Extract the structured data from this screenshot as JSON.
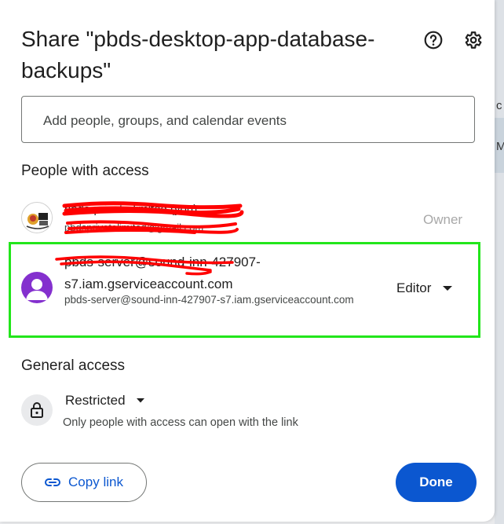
{
  "dialog": {
    "title": "Share \"pbds-desktop-app-database-backups\""
  },
  "add_people": {
    "placeholder": "Add people, groups, and calendar events"
  },
  "people_with_access": {
    "heading": "People with access",
    "owner": {
      "name": "pbds-private-limited (you)",
      "email": "pbdsprivatelimited@gmail.com",
      "role": "Owner"
    },
    "editor": {
      "name": "pbds-server@sound-inn-427907-s7.iam.gserviceaccount.com",
      "email": "pbds-server@sound-inn-427907-s7.iam.gserviceaccount.com",
      "role": "Editor"
    }
  },
  "general_access": {
    "heading": "General access",
    "mode": "Restricted",
    "description": "Only people with access can open with the link"
  },
  "footer": {
    "copy_link_label": "Copy link",
    "done_label": "Done"
  },
  "colors": {
    "primary": "#0b57d0",
    "editor_avatar": "#8430ce",
    "highlight": "#22e61b",
    "redaction": "#ff0000"
  },
  "icons": [
    "help-icon",
    "gear-icon",
    "lock-icon",
    "link-icon",
    "dropdown-caret-icon",
    "person-icon"
  ]
}
